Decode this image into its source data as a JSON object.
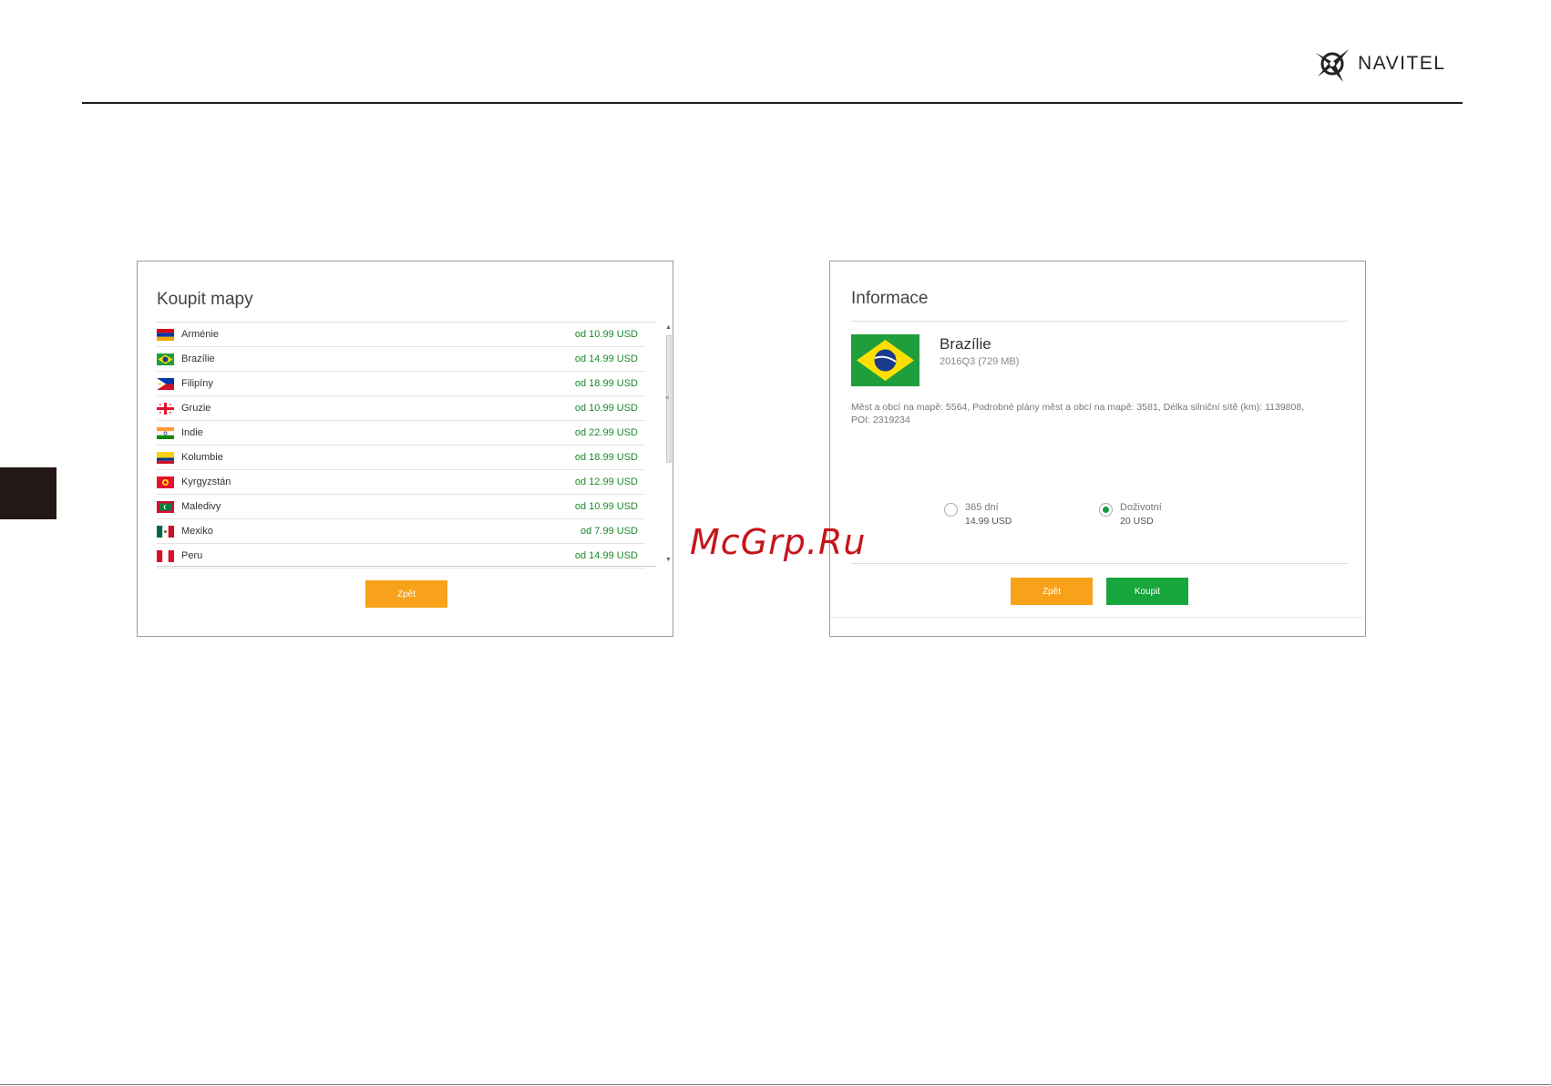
{
  "brand": {
    "name": "NAVITEL"
  },
  "buy_maps": {
    "title": "Koupit mapy",
    "items": [
      {
        "country": "Arménie",
        "price": "od 10.99 USD",
        "flag": "armenia"
      },
      {
        "country": "Brazílie",
        "price": "od 14.99 USD",
        "flag": "brazil"
      },
      {
        "country": "Filipíny",
        "price": "od 18.99 USD",
        "flag": "philippines"
      },
      {
        "country": "Gruzie",
        "price": "od 10.99 USD",
        "flag": "georgia"
      },
      {
        "country": "Indie",
        "price": "od 22.99 USD",
        "flag": "india"
      },
      {
        "country": "Kolumbie",
        "price": "od 18.99 USD",
        "flag": "colombia"
      },
      {
        "country": "Kyrgyzstán",
        "price": "od 12.99 USD",
        "flag": "kyrgyzstan"
      },
      {
        "country": "Maledivy",
        "price": "od 10.99 USD",
        "flag": "maldives"
      },
      {
        "country": "Mexiko",
        "price": "od 7.99 USD",
        "flag": "mexico"
      },
      {
        "country": "Peru",
        "price": "od 14.99 USD",
        "flag": "peru"
      }
    ],
    "back_label": "Zpět"
  },
  "info": {
    "title": "Informace",
    "country": "Brazílie",
    "version": "2016Q3 (729 MB)",
    "description": "Měst a obcí na mapě: 5564, Podrobné plány měst a obcí na mapě: 3581, Délka silniční sítě (km): 1139808, POI: 2319234",
    "options": [
      {
        "label": "365 dní",
        "price": "14.99 USD",
        "selected": false
      },
      {
        "label": "Doživotní",
        "price": "20 USD",
        "selected": true
      }
    ],
    "back_label": "Zpět",
    "buy_label": "Koupit"
  },
  "watermark": "McGrp.Ru",
  "colors": {
    "accent_orange": "#f7a21a",
    "accent_green": "#17a63c",
    "price_green": "#1a8a2a"
  }
}
